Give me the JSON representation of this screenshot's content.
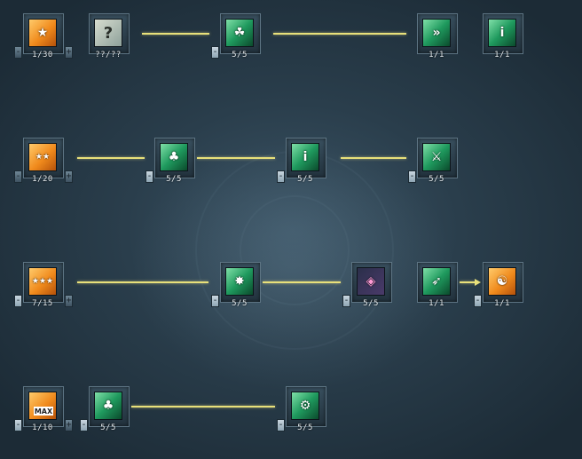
{
  "skill_tree": {
    "rows": [
      {
        "skills": [
          {
            "icon": "orange-star-sword-icon",
            "glyph": "★",
            "level": "1/30"
          },
          {
            "icon": "question-mark-icon",
            "glyph": "?",
            "level": "??/??"
          },
          {
            "icon": "green-skill-icon",
            "glyph": "☘",
            "level": "5/5"
          },
          {
            "icon": "green-dash-icon",
            "glyph": "»",
            "level": "1/1"
          },
          {
            "icon": "green-info-icon",
            "glyph": "i",
            "level": "1/1"
          }
        ]
      },
      {
        "skills": [
          {
            "icon": "orange-two-star-sword-icon",
            "glyph": "★★",
            "level": "1/20"
          },
          {
            "icon": "green-group-icon",
            "glyph": "♣",
            "level": "5/5"
          },
          {
            "icon": "green-info-icon",
            "glyph": "i",
            "level": "5/5"
          },
          {
            "icon": "green-sword-icon",
            "glyph": "⚔",
            "level": "5/5"
          }
        ]
      },
      {
        "skills": [
          {
            "icon": "orange-three-star-sword-icon",
            "glyph": "★★★",
            "level": "7/15"
          },
          {
            "icon": "green-burst-icon",
            "glyph": "✸",
            "level": "5/5"
          },
          {
            "icon": "pink-shield-icon",
            "glyph": "◈",
            "level": "5/5"
          },
          {
            "icon": "green-runner-icon",
            "glyph": "➶",
            "level": "1/1"
          },
          {
            "icon": "orange-meditation-icon",
            "glyph": "☯",
            "level": "1/1"
          }
        ]
      },
      {
        "skills": [
          {
            "icon": "orange-max-icon",
            "glyph": "MAX",
            "level": "1/10"
          },
          {
            "icon": "green-crowd-icon",
            "glyph": "♣",
            "level": "5/5"
          },
          {
            "icon": "green-gear-icon",
            "glyph": "⚙",
            "level": "5/5"
          }
        ]
      }
    ]
  },
  "controls": {
    "minus": "-",
    "plus": "+"
  },
  "colors": {
    "connector": "#e8e07a",
    "background": "#2a3e4c"
  }
}
